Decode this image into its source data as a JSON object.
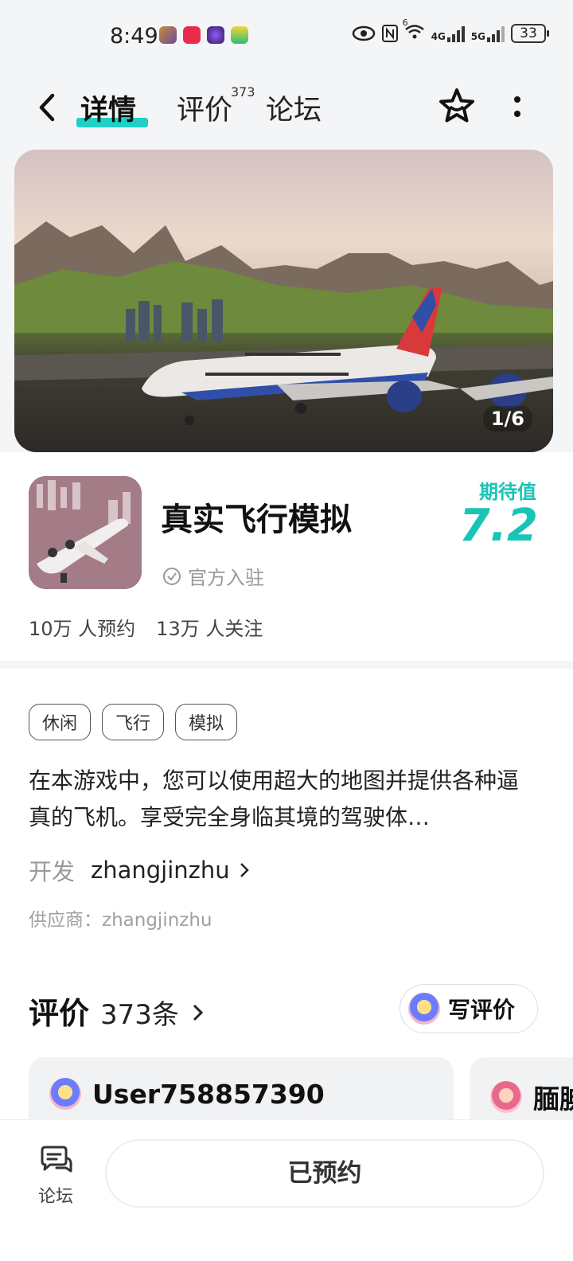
{
  "status_bar": {
    "time": "8:49",
    "battery": "33",
    "network_4g": "4G",
    "network_5g": "5G",
    "wifi_level": "6"
  },
  "nav": {
    "tab_detail": "详情",
    "tab_reviews": "评价",
    "tab_reviews_count": "373",
    "tab_forum": "论坛"
  },
  "hero": {
    "counter": "1/6"
  },
  "app": {
    "title": "真实飞行模拟",
    "official": "官方入驻",
    "rating_label": "期待值",
    "rating_value": "7.2",
    "reservations": "10万 人预约",
    "followers": "13万 人关注"
  },
  "detail": {
    "tags": [
      "休闲",
      "飞行",
      "模拟"
    ],
    "description": "在本游戏中，您可以使用超大的地图并提供各种逼真的飞机。享受完全身临其境的驾驶体…",
    "developer_label": "开发",
    "developer_name": "zhangjinzhu",
    "supplier": "供应商：zhangjinzhu"
  },
  "reviews": {
    "heading": "评价",
    "count": "373条",
    "write_label": "写评价",
    "cards": [
      {
        "user": "User758857390"
      },
      {
        "user": "腼腆"
      }
    ]
  },
  "bottom": {
    "forum_label": "论坛",
    "reserve_label": "已预约"
  },
  "colors": {
    "accent": "#1fd1c4",
    "rating": "#19c4b5"
  }
}
